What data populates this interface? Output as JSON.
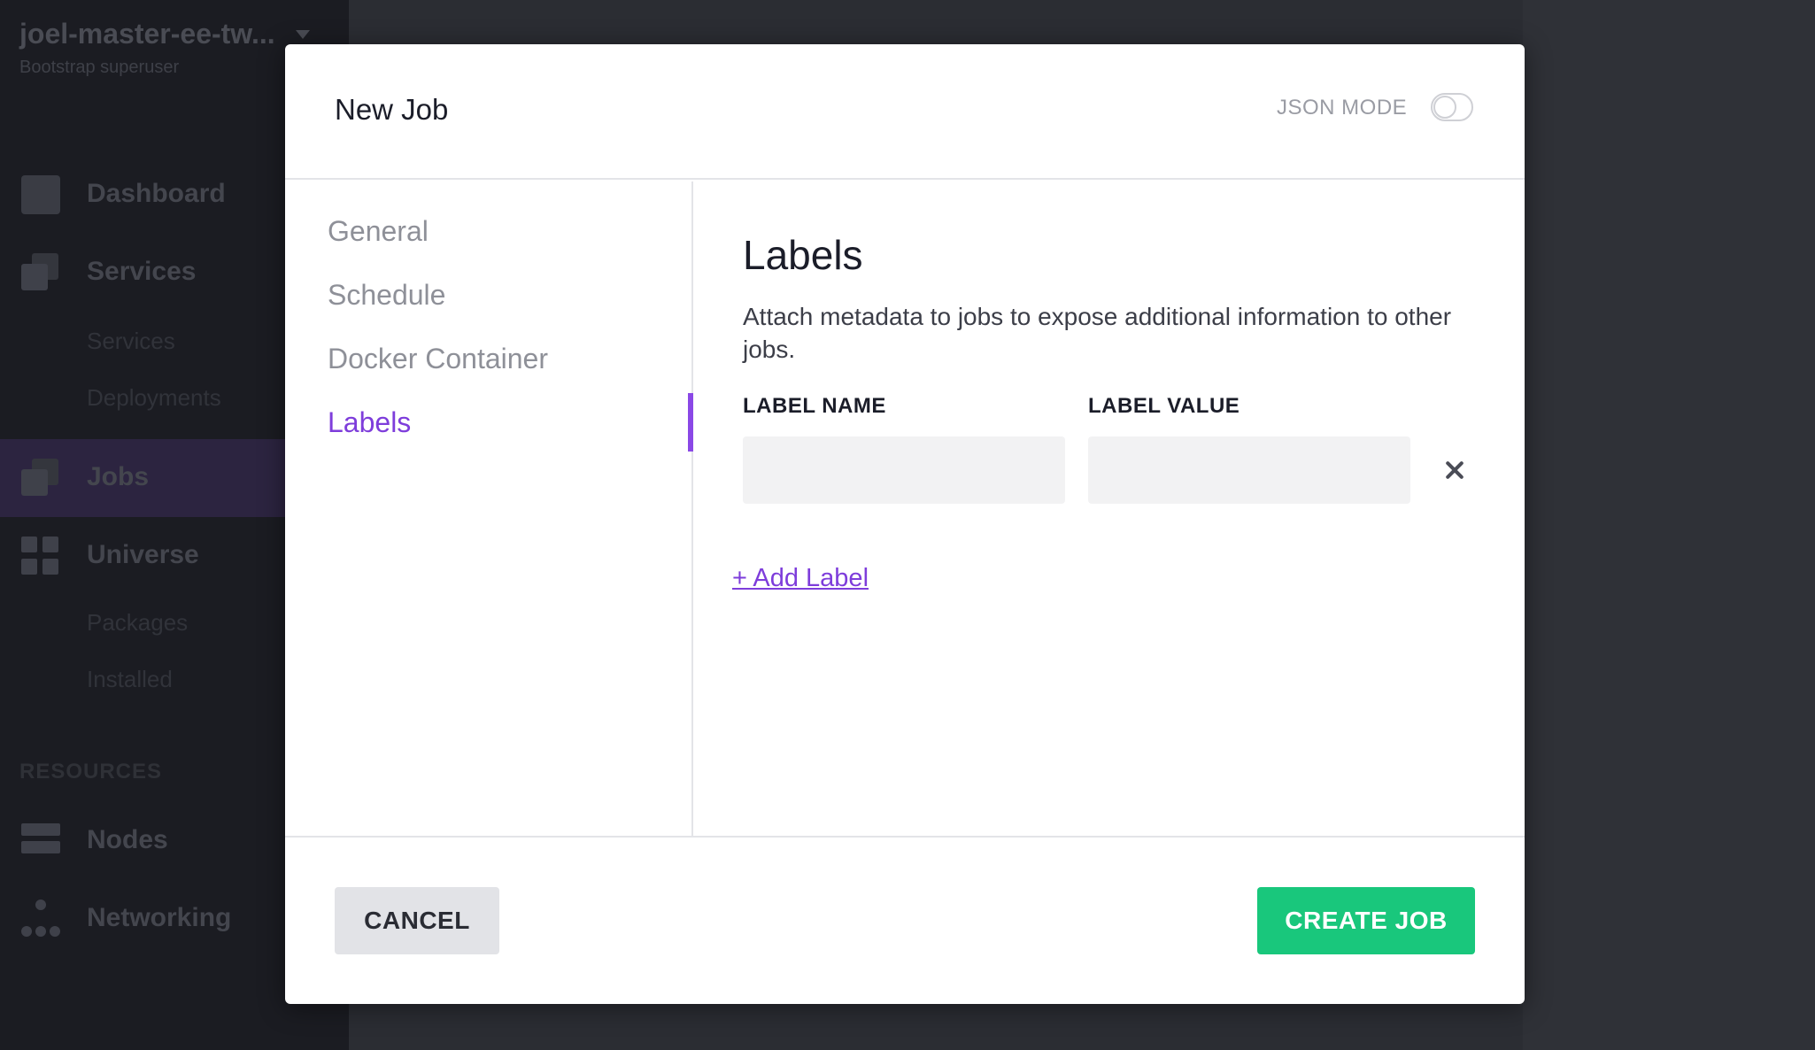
{
  "sidebar": {
    "cluster_name": "joel-master-ee-tw...",
    "user_role": "Bootstrap superuser",
    "items": [
      {
        "label": "Dashboard"
      },
      {
        "label": "Services"
      },
      {
        "label": "Jobs"
      },
      {
        "label": "Universe"
      },
      {
        "label": "Nodes"
      },
      {
        "label": "Networking"
      }
    ],
    "sub_items": {
      "services": [
        "Services",
        "Deployments"
      ],
      "universe": [
        "Packages",
        "Installed"
      ]
    },
    "section_resources": "RESOURCES",
    "active_item": "Jobs"
  },
  "modal": {
    "title": "New Job",
    "json_mode_label": "JSON MODE",
    "json_mode_enabled": false,
    "nav": [
      {
        "label": "General"
      },
      {
        "label": "Schedule"
      },
      {
        "label": "Docker Container"
      },
      {
        "label": "Labels"
      }
    ],
    "active_nav": "Labels",
    "labels_section": {
      "title": "Labels",
      "description": "Attach metadata to jobs to expose additional information to other jobs.",
      "label_name_header": "LABEL NAME",
      "label_value_header": "LABEL VALUE",
      "rows": [
        {
          "name": "",
          "value": ""
        }
      ],
      "add_label": "+ Add Label"
    },
    "cancel_label": "CANCEL",
    "create_label": "CREATE JOB"
  },
  "colors": {
    "accent_purple": "#7e3ddb",
    "create_green": "#19c77c",
    "sidebar_bg": "#1b1c22",
    "backdrop": "#2b2d33"
  }
}
